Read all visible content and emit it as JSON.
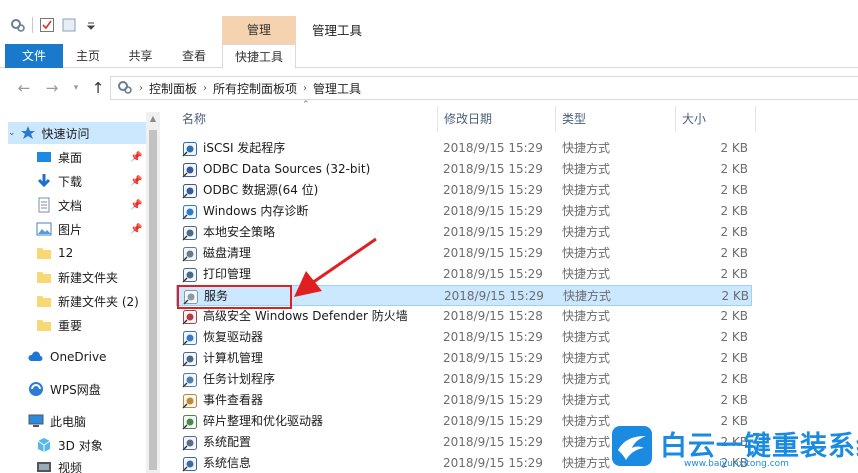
{
  "window": {
    "title": "管理工具",
    "context_tab": "管理",
    "accent": "#1979ca",
    "context_tab_color": "#f6d3b0"
  },
  "ribbon": {
    "tabs": [
      "文件",
      "主页",
      "共享",
      "查看",
      "快捷工具"
    ]
  },
  "address": {
    "crumbs": [
      "控制面板",
      "所有控制面板项",
      "管理工具"
    ],
    "root_icon": "control-panel-icon"
  },
  "nav": {
    "quick_access": "快速访问",
    "items": [
      {
        "label": "桌面",
        "icon": "desktop-icon",
        "pinned": true
      },
      {
        "label": "下载",
        "icon": "download-icon",
        "pinned": true
      },
      {
        "label": "文档",
        "icon": "document-icon",
        "pinned": true
      },
      {
        "label": "图片",
        "icon": "pictures-icon",
        "pinned": true
      },
      {
        "label": "12",
        "icon": "folder-icon",
        "pinned": false
      },
      {
        "label": "新建文件夹",
        "icon": "folder-icon",
        "pinned": false
      },
      {
        "label": "新建文件夹 (2)",
        "icon": "folder-icon",
        "pinned": false
      },
      {
        "label": "重要",
        "icon": "folder-icon",
        "pinned": false
      }
    ],
    "onedrive": "OneDrive",
    "wps": "WPS网盘",
    "this_pc": "此电脑",
    "objects3d": "3D 对象",
    "videos": "视频"
  },
  "columns": {
    "name": "名称",
    "date": "修改日期",
    "type": "类型",
    "size": "大小"
  },
  "files": [
    {
      "name": "iSCSI 发起程序",
      "date": "2018/9/15 15:29",
      "type": "快捷方式",
      "size": "2 KB",
      "icon": "iscsi-icon"
    },
    {
      "name": "ODBC Data Sources (32-bit)",
      "date": "2018/9/15 15:29",
      "type": "快捷方式",
      "size": "2 KB",
      "icon": "odbc-icon"
    },
    {
      "name": "ODBC 数据源(64 位)",
      "date": "2018/9/15 15:29",
      "type": "快捷方式",
      "size": "2 KB",
      "icon": "odbc-icon"
    },
    {
      "name": "Windows 内存诊断",
      "date": "2018/9/15 15:29",
      "type": "快捷方式",
      "size": "2 KB",
      "icon": "memory-diagnostic-icon"
    },
    {
      "name": "本地安全策略",
      "date": "2018/9/15 15:29",
      "type": "快捷方式",
      "size": "2 KB",
      "icon": "security-policy-icon"
    },
    {
      "name": "磁盘清理",
      "date": "2018/9/15 15:29",
      "type": "快捷方式",
      "size": "2 KB",
      "icon": "disk-cleanup-icon"
    },
    {
      "name": "打印管理",
      "date": "2018/9/15 15:29",
      "type": "快捷方式",
      "size": "2 KB",
      "icon": "print-management-icon"
    },
    {
      "name": "服务",
      "date": "2018/9/15 15:29",
      "type": "快捷方式",
      "size": "2 KB",
      "icon": "services-gear-icon",
      "selected": true
    },
    {
      "name": "高级安全 Windows Defender 防火墙",
      "date": "2018/9/15 15:28",
      "type": "快捷方式",
      "size": "2 KB",
      "icon": "firewall-icon"
    },
    {
      "name": "恢复驱动器",
      "date": "2018/9/15 15:29",
      "type": "快捷方式",
      "size": "2 KB",
      "icon": "recovery-drive-icon"
    },
    {
      "name": "计算机管理",
      "date": "2018/9/15 15:29",
      "type": "快捷方式",
      "size": "2 KB",
      "icon": "computer-management-icon"
    },
    {
      "name": "任务计划程序",
      "date": "2018/9/15 15:29",
      "type": "快捷方式",
      "size": "2 KB",
      "icon": "task-scheduler-icon"
    },
    {
      "name": "事件查看器",
      "date": "2018/9/15 15:29",
      "type": "快捷方式",
      "size": "2 KB",
      "icon": "event-viewer-icon"
    },
    {
      "name": "碎片整理和优化驱动器",
      "date": "2018/9/15 15:29",
      "type": "快捷方式",
      "size": "2 KB",
      "icon": "defrag-icon"
    },
    {
      "name": "系统配置",
      "date": "2018/9/15 15:29",
      "type": "快捷方式",
      "size": "2 KB",
      "icon": "system-config-icon"
    },
    {
      "name": "系统信息",
      "date": "2018/9/15 15:29",
      "type": "快捷方式",
      "size": "2 KB",
      "icon": "system-info-icon"
    }
  ],
  "watermark": {
    "title": "白云一键重装系统",
    "url": "www.baiyunxitong.com",
    "color": "#1a8be0"
  },
  "annotation_color": "#e02020"
}
